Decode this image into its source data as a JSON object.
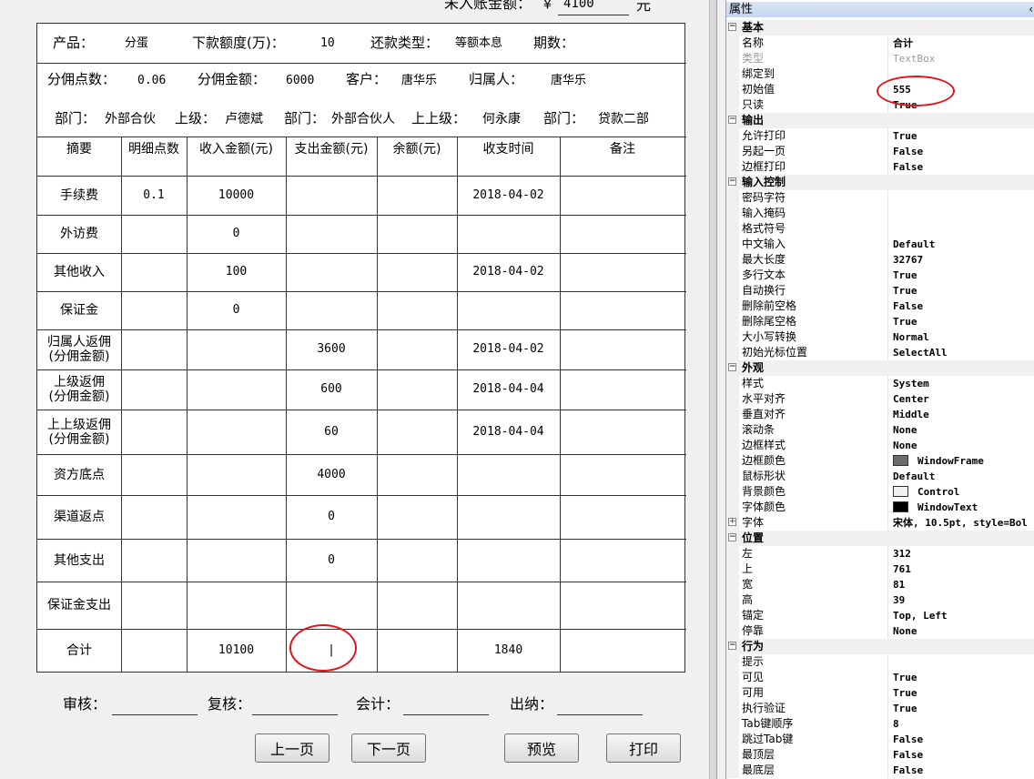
{
  "header": {
    "label": "未入账金额：",
    "currency": "￥",
    "value": "4100",
    "unit": "元"
  },
  "info": {
    "product_label": "产品：",
    "product": "分蛋",
    "amount_label": "下款额度(万)：",
    "amount": "10",
    "repay_label": "还款类型：",
    "repay": "等额本息",
    "term_label": "期数：",
    "term": "",
    "commission_rate_label": "分佣点数：",
    "commission_rate": "0.06",
    "commission_amount_label": "分佣金额：",
    "commission_amount": "6000",
    "customer_label": "客户：",
    "customer": "唐华乐",
    "owner_label": "归属人：",
    "owner": "唐华乐",
    "dept_label": "部门：",
    "dept": "外部合伙",
    "superior_label": "上级：",
    "superior": "卢德斌",
    "dept2_label": "部门：",
    "dept2": "外部合伙人",
    "superior2_label": "上上级：",
    "superior2": "何永康",
    "dept3_label": "部门：",
    "dept3": "贷款二部"
  },
  "table": {
    "headers": [
      "摘要",
      "明细点数",
      "收入金额(元)",
      "支出金额(元)",
      "余额(元)",
      "收支时间",
      "备注"
    ],
    "rows": [
      {
        "summary": "手续费",
        "rate": "0.1",
        "income": "10000",
        "expense": "",
        "balance": "",
        "time": "2018-04-02",
        "note": ""
      },
      {
        "summary": "外访费",
        "rate": "",
        "income": "0",
        "expense": "",
        "balance": "",
        "time": "",
        "note": ""
      },
      {
        "summary": "其他收入",
        "rate": "",
        "income": "100",
        "expense": "",
        "balance": "",
        "time": "2018-04-02",
        "note": ""
      },
      {
        "summary": "保证金",
        "rate": "",
        "income": "0",
        "expense": "",
        "balance": "",
        "time": "",
        "note": ""
      },
      {
        "summary": "归属人返佣\n(分佣金额)",
        "rate": "",
        "income": "",
        "expense": "3600",
        "balance": "",
        "time": "2018-04-02",
        "note": ""
      },
      {
        "summary": "上级返佣\n(分佣金额)",
        "rate": "",
        "income": "",
        "expense": "600",
        "balance": "",
        "time": "2018-04-04",
        "note": ""
      },
      {
        "summary": "上上级返佣\n(分佣金额)",
        "rate": "",
        "income": "",
        "expense": "60",
        "balance": "",
        "time": "2018-04-04",
        "note": ""
      },
      {
        "summary": "资方底点",
        "rate": "",
        "income": "",
        "expense": "4000",
        "balance": "",
        "time": "",
        "note": ""
      },
      {
        "summary": "渠道返点",
        "rate": "",
        "income": "",
        "expense": "0",
        "balance": "",
        "time": "",
        "note": ""
      },
      {
        "summary": "其他支出",
        "rate": "",
        "income": "",
        "expense": "0",
        "balance": "",
        "time": "",
        "note": ""
      },
      {
        "summary": "保证金支出",
        "rate": "",
        "income": "",
        "expense": "",
        "balance": "",
        "time": "",
        "note": ""
      },
      {
        "summary": "合计",
        "rate": "",
        "income": "10100",
        "expense": "|",
        "balance": "",
        "time": "1840",
        "note": ""
      }
    ]
  },
  "signatures": {
    "audit": "审核：",
    "review": "复核：",
    "accountant": "会计：",
    "cashier": "出纳："
  },
  "buttons": {
    "prev": "上一页",
    "next": "下一页",
    "preview": "预览",
    "print": "打印"
  },
  "properties_panel": {
    "title": "属性",
    "title_right": "‹",
    "rows": [
      {
        "type": "cat",
        "name": "基本",
        "toggle": "−"
      },
      {
        "name": "名称",
        "value": "合计"
      },
      {
        "name": "类型",
        "value": "TextBox",
        "dim": true
      },
      {
        "name": "绑定到",
        "value": ""
      },
      {
        "name": "初始值",
        "value": "555"
      },
      {
        "name": "只读",
        "value": "True"
      },
      {
        "type": "cat",
        "name": "输出",
        "toggle": "−"
      },
      {
        "name": "允许打印",
        "value": "True"
      },
      {
        "name": "另起一页",
        "value": "False"
      },
      {
        "name": "边框打印",
        "value": "False"
      },
      {
        "type": "cat",
        "name": "输入控制",
        "toggle": "−"
      },
      {
        "name": "密码字符",
        "value": ""
      },
      {
        "name": "输入掩码",
        "value": ""
      },
      {
        "name": "格式符号",
        "value": ""
      },
      {
        "name": "中文输入",
        "value": "Default"
      },
      {
        "name": "最大长度",
        "value": "32767"
      },
      {
        "name": "多行文本",
        "value": "True"
      },
      {
        "name": "自动换行",
        "value": "True"
      },
      {
        "name": "删除前空格",
        "value": "False"
      },
      {
        "name": "删除尾空格",
        "value": "True"
      },
      {
        "name": "大小写转换",
        "value": "Normal"
      },
      {
        "name": "初始光标位置",
        "value": "SelectAll"
      },
      {
        "type": "cat",
        "name": "外观",
        "toggle": "−"
      },
      {
        "name": "样式",
        "value": "System"
      },
      {
        "name": "水平对齐",
        "value": "Center"
      },
      {
        "name": "垂直对齐",
        "value": "Middle"
      },
      {
        "name": "滚动条",
        "value": "None"
      },
      {
        "name": "边框样式",
        "value": "None"
      },
      {
        "name": "边框颜色",
        "value": "WindowFrame",
        "swatch": "#6b6b6b"
      },
      {
        "name": "鼠标形状",
        "value": "Default"
      },
      {
        "name": "背景颜色",
        "value": "Control",
        "swatch": "#f0f0f0"
      },
      {
        "name": "字体颜色",
        "value": "WindowText",
        "swatch": "#000000"
      },
      {
        "name": "字体",
        "value": "宋体, 10.5pt, style=Bol",
        "toggle": "+"
      },
      {
        "type": "cat",
        "name": "位置",
        "toggle": "−"
      },
      {
        "name": "左",
        "value": "312"
      },
      {
        "name": "上",
        "value": "761"
      },
      {
        "name": "宽",
        "value": "81"
      },
      {
        "name": "高",
        "value": "39"
      },
      {
        "name": "锚定",
        "value": "Top, Left"
      },
      {
        "name": "停靠",
        "value": "None"
      },
      {
        "type": "cat",
        "name": "行为",
        "toggle": "−"
      },
      {
        "name": "提示",
        "value": ""
      },
      {
        "name": "可见",
        "value": "True"
      },
      {
        "name": "可用",
        "value": "True"
      },
      {
        "name": "执行验证",
        "value": "True"
      },
      {
        "name": "Tab键顺序",
        "value": "8"
      },
      {
        "name": "跳过Tab键",
        "value": "False"
      },
      {
        "name": "最顶层",
        "value": "False"
      },
      {
        "name": "最底层",
        "value": "False"
      }
    ]
  },
  "colors": {
    "annotation_red": "#e0161b",
    "grid_line": "#333333"
  }
}
